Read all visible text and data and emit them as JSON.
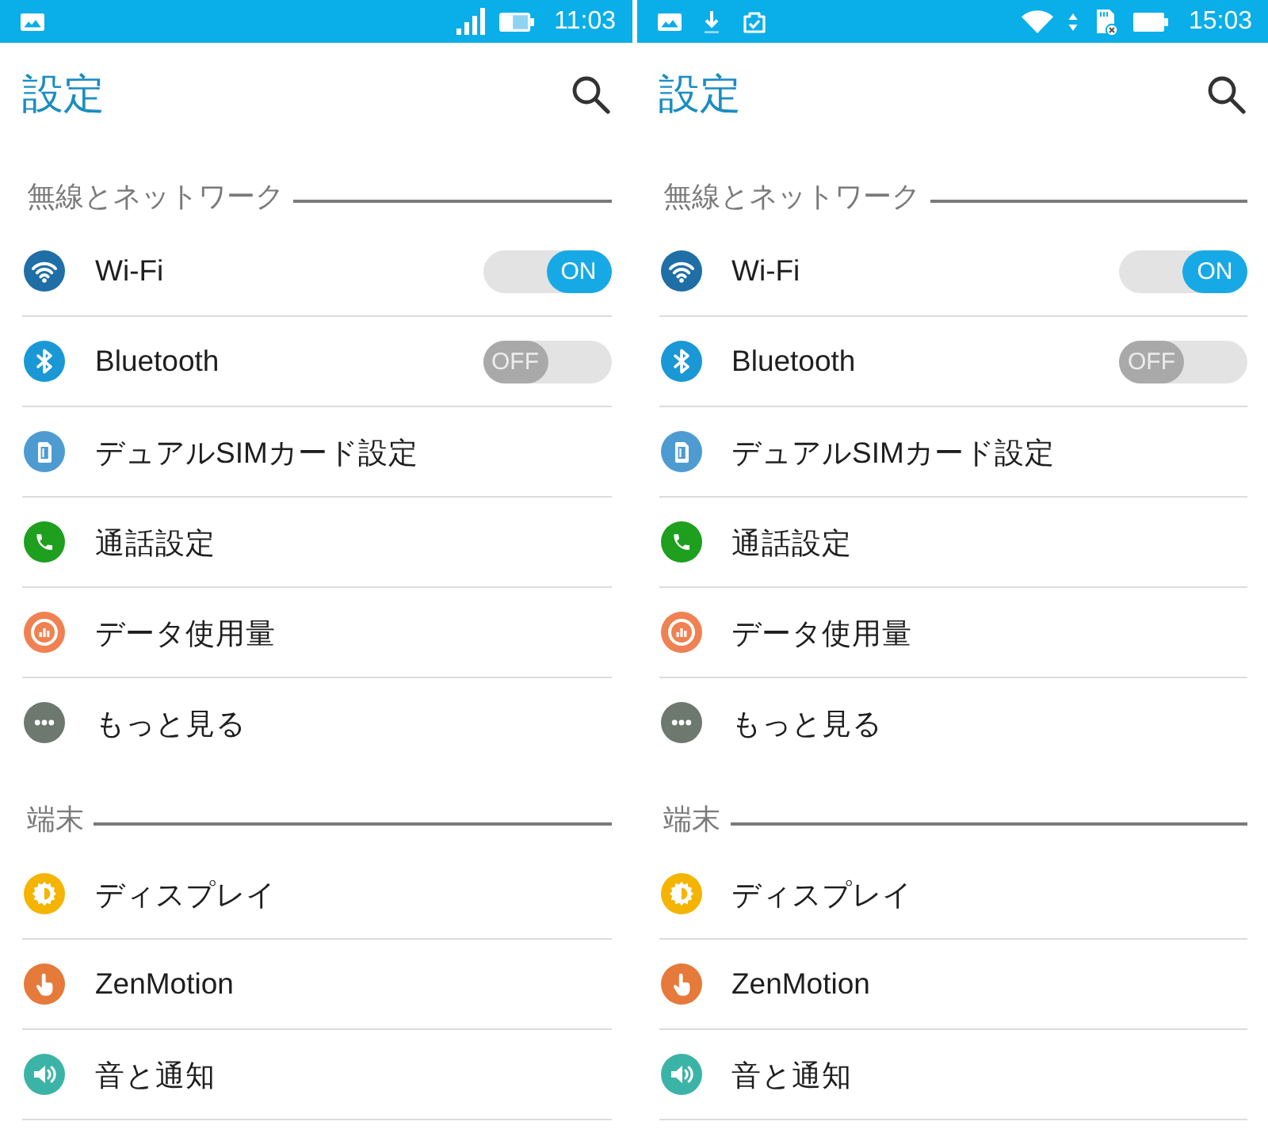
{
  "screens": [
    {
      "status_bar": {
        "time": "11:03"
      },
      "header": {
        "title": "設定"
      },
      "sections": [
        {
          "title": "無線とネットワーク",
          "items": [
            {
              "label": "Wi-Fi",
              "kind": "toggle",
              "on": true,
              "switch_text": "ON"
            },
            {
              "label": "Bluetooth",
              "kind": "toggle",
              "on": false,
              "switch_text": "OFF"
            },
            {
              "label": "デュアルSIMカード設定",
              "kind": "link"
            },
            {
              "label": "通話設定",
              "kind": "link"
            },
            {
              "label": "データ使用量",
              "kind": "link"
            },
            {
              "label": "もっと見る",
              "kind": "link"
            }
          ]
        },
        {
          "title": "端末",
          "items": [
            {
              "label": "ディスプレイ",
              "kind": "link"
            },
            {
              "label": "ZenMotion",
              "kind": "link"
            },
            {
              "label": "音と通知",
              "kind": "link"
            }
          ]
        }
      ]
    },
    {
      "status_bar": {
        "time": "15:03"
      },
      "header": {
        "title": "設定"
      },
      "sections": [
        {
          "title": "無線とネットワーク",
          "items": [
            {
              "label": "Wi-Fi",
              "kind": "toggle",
              "on": true,
              "switch_text": "ON"
            },
            {
              "label": "Bluetooth",
              "kind": "toggle",
              "on": false,
              "switch_text": "OFF"
            },
            {
              "label": "デュアルSIMカード設定",
              "kind": "link"
            },
            {
              "label": "通話設定",
              "kind": "link"
            },
            {
              "label": "データ使用量",
              "kind": "link"
            },
            {
              "label": "もっと見る",
              "kind": "link"
            }
          ]
        },
        {
          "title": "端末",
          "items": [
            {
              "label": "ディスプレイ",
              "kind": "link"
            },
            {
              "label": "ZenMotion",
              "kind": "link"
            },
            {
              "label": "音と通知",
              "kind": "link"
            }
          ]
        }
      ]
    }
  ]
}
